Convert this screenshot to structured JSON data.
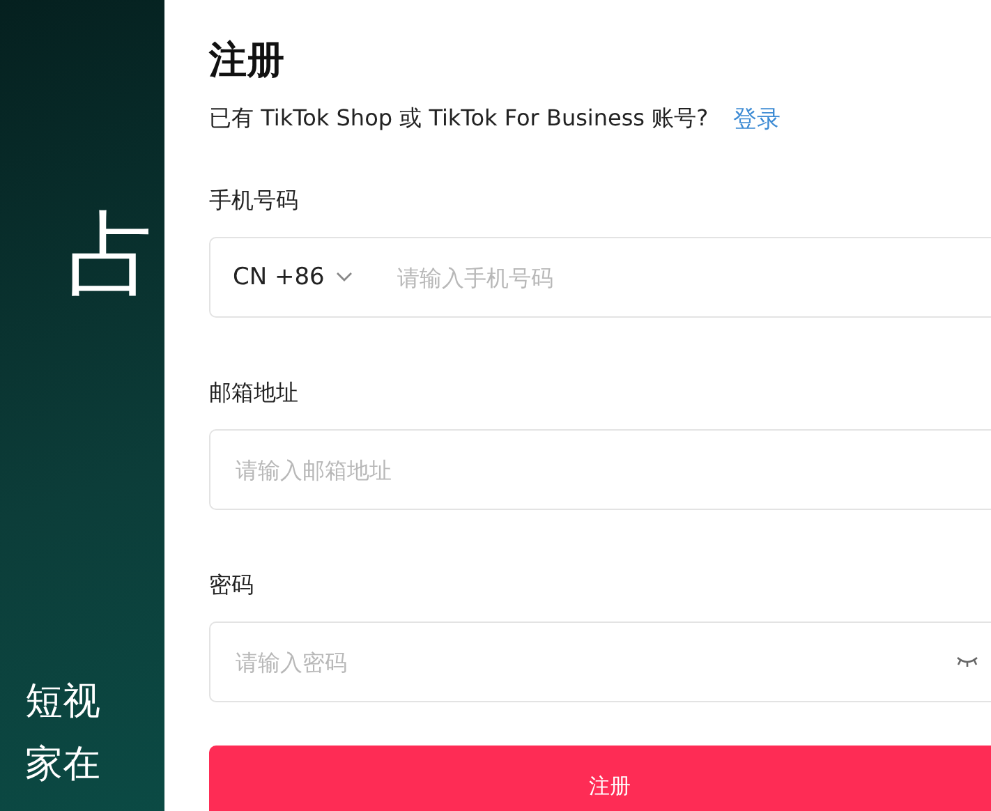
{
  "side_panel": {
    "headline": "占",
    "lines": [
      "短视",
      "家在"
    ]
  },
  "form": {
    "title": "注册",
    "subtitle": "已有 TikTok Shop 或 TikTok For Business 账号?",
    "login_link": "登录",
    "fields": [
      {
        "kind": "phone",
        "label": "手机号码",
        "country_code": "CN +86",
        "placeholder": "请输入手机号码"
      },
      {
        "kind": "text",
        "label": "邮箱地址",
        "placeholder": "请输入邮箱地址"
      },
      {
        "kind": "password",
        "label": "密码",
        "placeholder": "请输入密码"
      }
    ],
    "submit": "注册"
  }
}
